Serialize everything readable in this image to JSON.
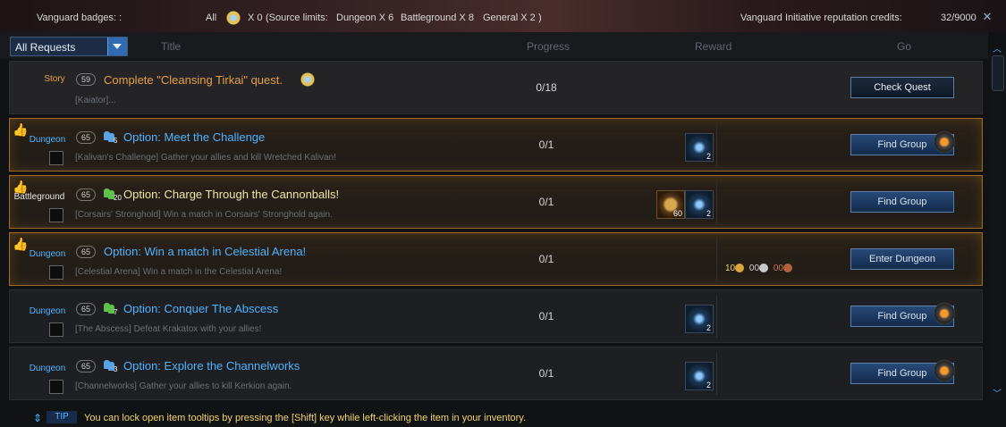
{
  "topbar": {
    "badges_label": "Vanguard badges: :",
    "all_label": "All",
    "badge_count": "X 0",
    "source_open": "(Source limits:",
    "dungeon_limit": "Dungeon X 6",
    "battleground_limit": "Battleground X 8",
    "general_limit": "General X 2",
    "source_close": ")",
    "credits_label": "Vanguard Initiative reputation credits:",
    "credits_value": "32/9000"
  },
  "filter": {
    "selected": "All Requests"
  },
  "columns": {
    "title": "Title",
    "progress": "Progress",
    "reward": "Reward",
    "go": "Go"
  },
  "quests": [
    {
      "category": "Story",
      "level": "59",
      "title": "Complete \"Cleansing Tirkai\" quest.",
      "desc": "[Kaiator]...",
      "progress": "0/18",
      "action": "Check Quest"
    },
    {
      "category": "Dungeon",
      "level": "65",
      "party": "5",
      "title": "Option: Meet the Challenge",
      "desc": "[Kalivan's Challenge] Gather your allies and kill Wretched Kalivan!",
      "progress": "0/1",
      "reward_count": "2",
      "action": "Find Group"
    },
    {
      "category": "Battleground",
      "level": "65",
      "party": "20",
      "title": "Option: Charge Through the Cannonballs!",
      "desc": "[Corsairs' Stronghold] Win a match in Corsairs' Stronghold again.",
      "progress": "0/1",
      "reward_count_a": "60",
      "reward_count_b": "2",
      "action": "Find Group"
    },
    {
      "category": "Dungeon",
      "level": "65",
      "title": "Option: Win a match in Celestial Arena!",
      "desc": "[Celestial Arena] Win a match in the Celestial Arena!",
      "progress": "0/1",
      "gold": "10",
      "silver": "00",
      "copper": "00",
      "action": "Enter Dungeon"
    },
    {
      "category": "Dungeon",
      "level": "65",
      "party": "7",
      "title": "Option: Conquer The Abscess",
      "desc": "[The Abscess] Defeat Krakatox with your allies!",
      "progress": "0/1",
      "reward_count": "2",
      "action": "Find Group"
    },
    {
      "category": "Dungeon",
      "level": "65",
      "party": "3",
      "title": "Option: Explore the Channelworks",
      "desc": "[Channelworks] Gather your allies to kill Kerkion again.",
      "progress": "0/1",
      "reward_count": "2",
      "action": "Find Group"
    }
  ],
  "footer": {
    "tip_label": "TIP",
    "tip_text": "You can lock open item tooltips by pressing the [Shift] key while left-clicking the item in your inventory."
  },
  "icons": [
    "vanguard-badge-icon",
    "close-icon",
    "thumbs-up-icon",
    "party-icon",
    "reward-item-icon",
    "horseshoe-icon",
    "lantern-icon",
    "coin-icon",
    "scroll-arrow-icon"
  ]
}
